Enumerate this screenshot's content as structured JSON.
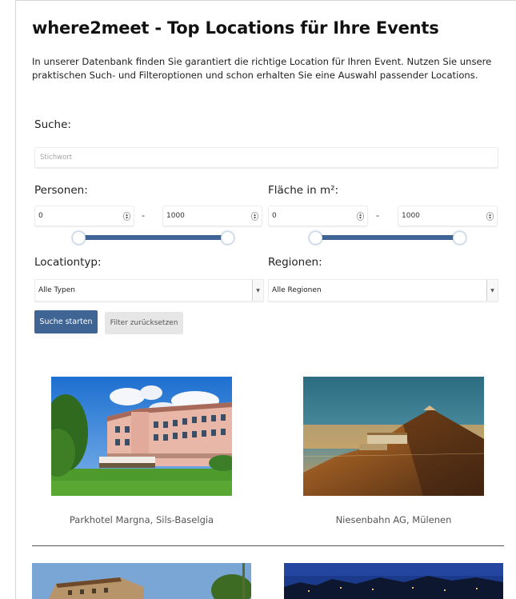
{
  "badge": "1",
  "page": {
    "title": "where2meet - Top Locations für Ihre Events",
    "intro": "In unserer Datenbank finden Sie garantiert die richtige Location für Ihren Event. Nutzen Sie unsere praktischen Such- und Filteroptionen und schon erhalten Sie eine Auswahl passender Locations."
  },
  "search": {
    "label": "Suche:",
    "placeholder": "Stichwort"
  },
  "persons": {
    "label": "Personen:",
    "min": "0",
    "max": "1000",
    "separator": "-",
    "range": [
      0,
      1000
    ]
  },
  "area": {
    "label": "Fläche in m²:",
    "min": "0",
    "max": "1000",
    "separator": "-",
    "range": [
      0,
      1000
    ]
  },
  "location_type": {
    "label": "Locationtyp:",
    "selected": "Alle Typen"
  },
  "regions": {
    "label": "Regionen:",
    "selected": "Alle Regionen"
  },
  "buttons": {
    "start": "Suche starten",
    "reset": "Filter zurücksetzen"
  },
  "results": [
    {
      "name": "Parkhotel Margna, Sils-Baselgia"
    },
    {
      "name": "Niesenbahn AG, Mülenen"
    }
  ],
  "colors": {
    "accent": "#3e6594",
    "badge": "#e0001a"
  }
}
